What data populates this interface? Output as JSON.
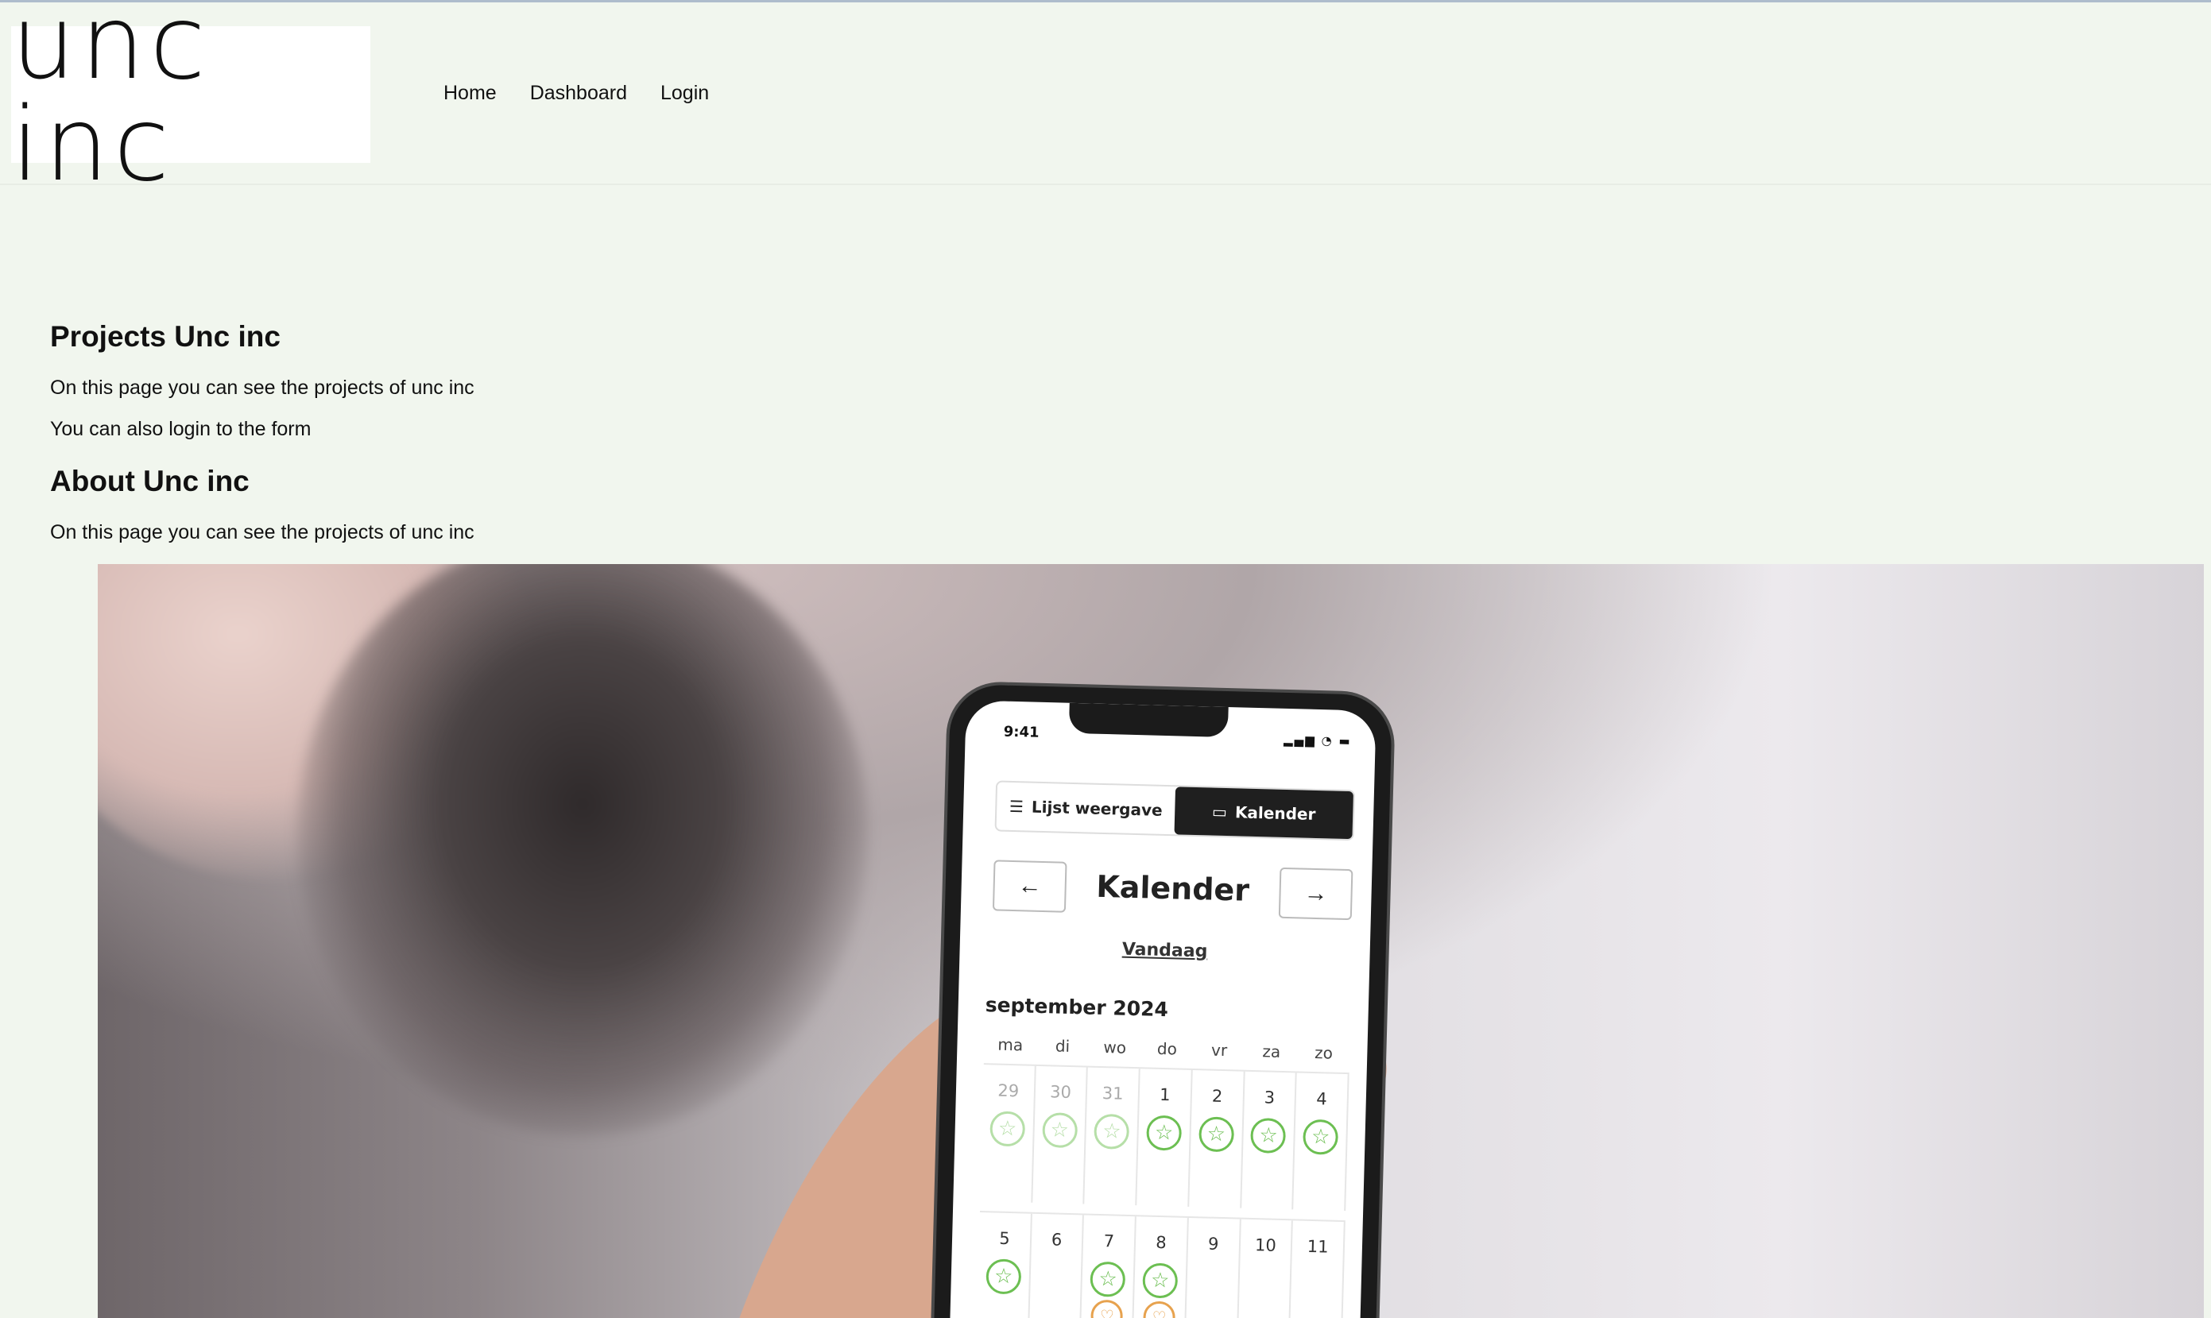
{
  "header": {
    "logo_text": "unc inc",
    "nav": [
      "Home",
      "Dashboard",
      "Login"
    ]
  },
  "main": {
    "projects_heading": "Projects Unc inc",
    "projects_text_1": "On this page you can see the projects of unc inc",
    "projects_text_2": "You can also login to the form",
    "about_heading": "About Unc inc",
    "about_text": "On this page you can see the projects of unc inc"
  },
  "hero_phone": {
    "time": "9:41",
    "status_icons": "signal-wifi-battery",
    "segment_list_label": "Lijst weergave",
    "segment_calendar_label": "Kalender",
    "calendar_title": "Kalender",
    "today_link": "Vandaag",
    "month_label": "september 2024",
    "weekdays": [
      "ma",
      "di",
      "wo",
      "do",
      "vr",
      "za",
      "zo"
    ],
    "week1": [
      "29",
      "30",
      "31",
      "1",
      "2",
      "3",
      "4"
    ],
    "week2": [
      "5",
      "6",
      "7",
      "8",
      "9",
      "10",
      "11"
    ],
    "colors": {
      "star": "#6cbf52",
      "heart": "#e7a24e",
      "active_segment": "#1f1f1f"
    }
  }
}
